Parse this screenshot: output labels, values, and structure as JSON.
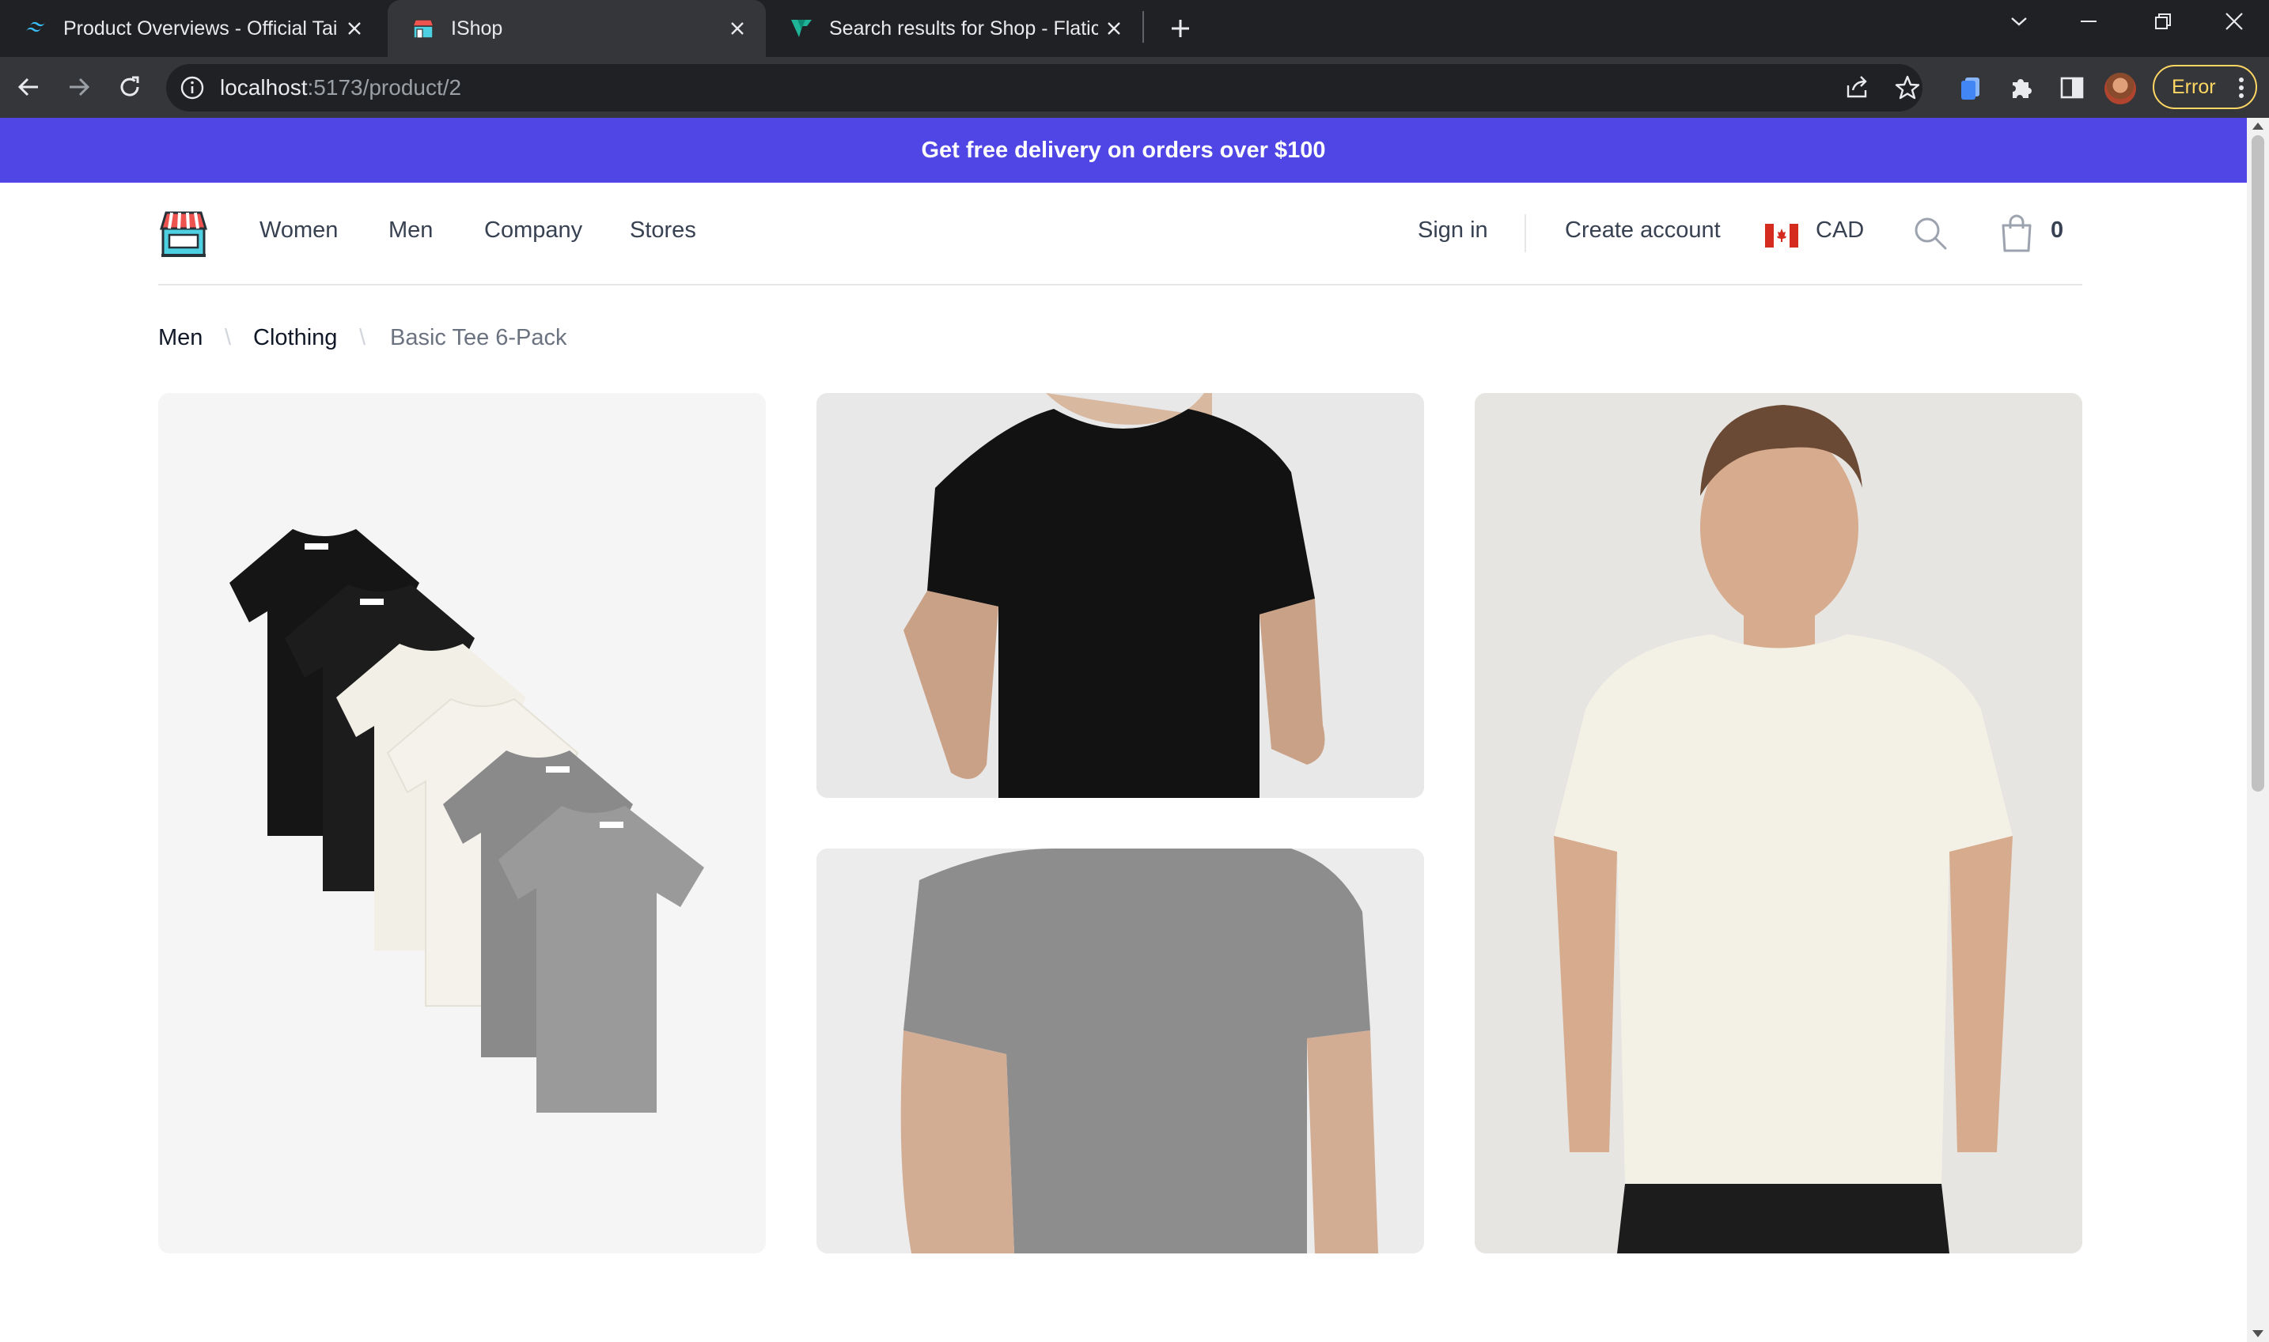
{
  "browser": {
    "tabs": [
      {
        "title": "Product Overviews - Official Tailw",
        "favicon": "tailwind-icon"
      },
      {
        "title": "IShop",
        "favicon": "shop-icon"
      },
      {
        "title": "Search results for Shop - Flaticon",
        "favicon": "flaticon-icon"
      }
    ],
    "active_tab_index": 1,
    "url_host": "localhost",
    "url_path": ":5173/product/2",
    "profile_status": "Error"
  },
  "promo": {
    "text": "Get free delivery on orders over $100"
  },
  "header": {
    "nav": [
      "Women",
      "Men",
      "Company",
      "Stores"
    ],
    "sign_in": "Sign in",
    "create_account": "Create account",
    "currency": "CAD",
    "cart_count": "0"
  },
  "breadcrumb": {
    "items": [
      "Men",
      "Clothing"
    ],
    "current": "Basic Tee 6-Pack",
    "separator": "\\"
  },
  "gallery": {
    "images": [
      {
        "alt": "Stack of six t-shirts: black, white and heather gray"
      },
      {
        "alt": "Model wearing black t-shirt"
      },
      {
        "alt": "Model wearing heather gray t-shirt"
      },
      {
        "alt": "Model wearing off-white t-shirt"
      }
    ]
  },
  "colors": {
    "promo_bg": "#4f46e5",
    "text_primary": "#111827",
    "text_secondary": "#374151",
    "error_accent": "#fdd663"
  }
}
